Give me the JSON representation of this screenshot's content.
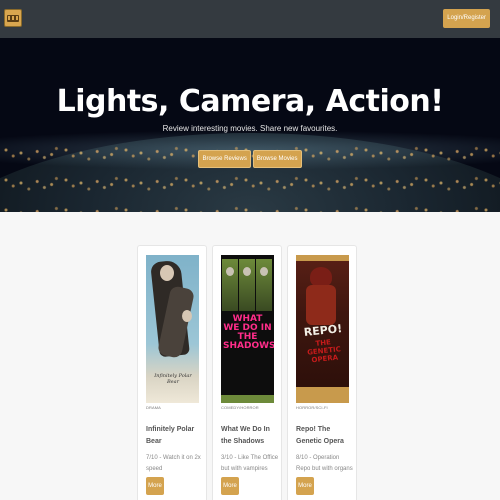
{
  "navbar": {
    "logo_icon": "film-reel-icon",
    "login_label": "Login/Register"
  },
  "hero": {
    "title": "Lights, Camera, Action!",
    "subtitle": "Review interesting movies. Share new favourites.",
    "browse_reviews_label": "Browse Reviews",
    "browse_movies_label": "Browse Movies"
  },
  "cards": [
    {
      "genre": "DRAMA",
      "title": "Infinitely Polar Bear",
      "description": "7/10 - Watch it on 2x speed",
      "more_label": "More",
      "poster_text": "Infinitely Polar Bear"
    },
    {
      "genre": "COMEDY/HORROR",
      "title": "What We Do In the Shadows",
      "description": "3/10 - Like The Office but with vampires",
      "more_label": "More",
      "poster_text": "WHAT WE DO IN THE SHADOWS"
    },
    {
      "genre": "HORROR/SCI-FI",
      "title": "Repo! The Genetic Opera",
      "description": "8/10 - Operation Repo but with organs",
      "more_label": "More",
      "poster_text": "REPO!",
      "poster_text2": "THE GENETIC OPERA"
    }
  ],
  "colors": {
    "navbar": "#343a40",
    "accent": "#d4a34f"
  }
}
